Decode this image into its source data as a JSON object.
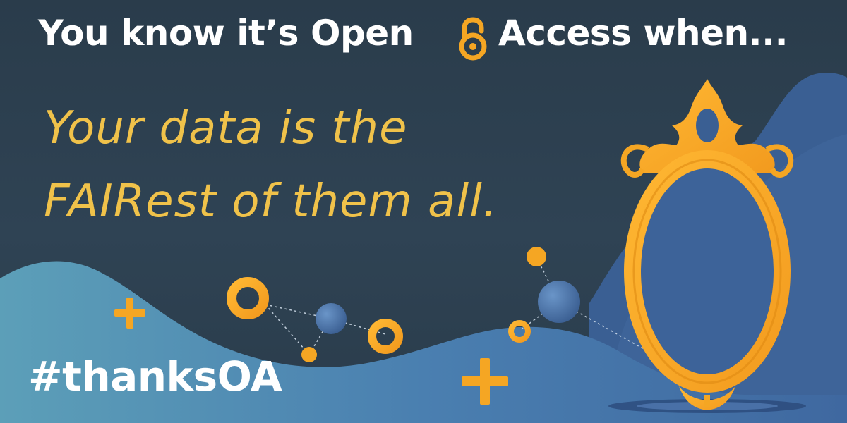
{
  "headline": {
    "before_icon": "You know it’s Open",
    "icon": "open-access-lock-icon",
    "after_icon": "Access when..."
  },
  "tagline": {
    "line1": "Your data is the",
    "line2": "FAIRest of them all."
  },
  "hashtag": "#thanksOA",
  "colors": {
    "background": "#2c3e4e",
    "accent_orange": "#f5a623",
    "wave_blue": "#3a5f93",
    "wave_teal": "#5a9bb5",
    "headline_text": "#ffffff",
    "tagline_text": "#f0c24a"
  },
  "illustration": {
    "mirror": "ornate-oval-mirror",
    "decorations": [
      "plus-icon",
      "ring",
      "node-sphere"
    ]
  }
}
